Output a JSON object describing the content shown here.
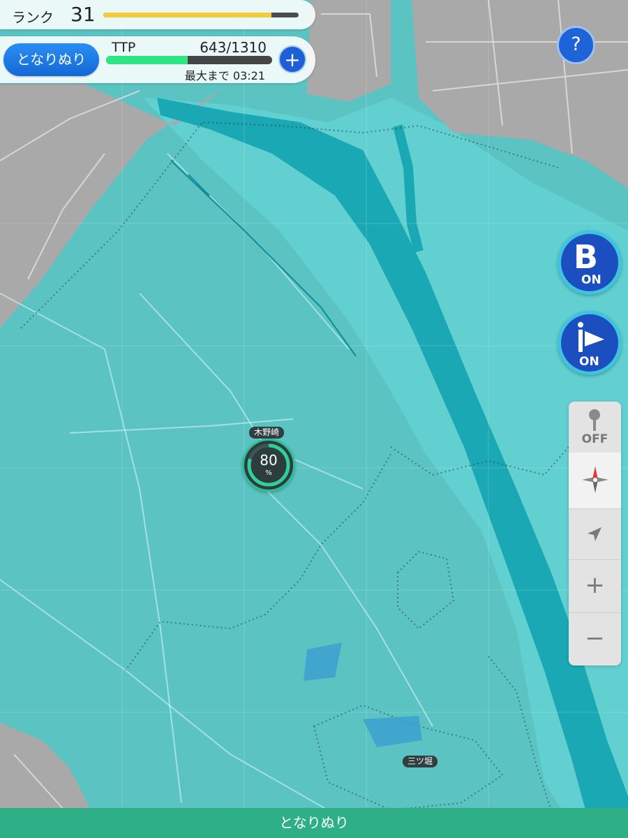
{
  "hud": {
    "rank_label": "ランク",
    "rank_value": "31",
    "rank_progress": 0.86,
    "mode_button_label": "となりぬり",
    "ttp_label": "TTP",
    "ttp_value": "643/1310",
    "ttp_current": 643,
    "ttp_max": 1310,
    "timer_text": "最大まで 03:21",
    "plus_label": "+"
  },
  "controls": {
    "help_label": "?",
    "b_toggle_letter": "B",
    "b_toggle_state": "ON",
    "flag_toggle_state": "ON",
    "pin_state": "OFF",
    "zoom_in_label": "+",
    "zoom_out_label": "−",
    "icons": [
      "help-icon",
      "b-mode-icon",
      "flag-icon",
      "pin-icon",
      "compass-icon",
      "locate-arrow-icon"
    ]
  },
  "map": {
    "area_name": "木野崎",
    "area_percent_value": 80,
    "area_percent": "80",
    "area_unit": "%",
    "place_label_2": "三ツ堀",
    "colors": {
      "painted": "#5cc3c3",
      "river": "#1aa9b4",
      "unpainted": "#a8a8a8",
      "accent_blue": "#1f63d8",
      "accent_green": "#2faf86"
    }
  },
  "footer": {
    "mode_label": "となりぬり"
  }
}
